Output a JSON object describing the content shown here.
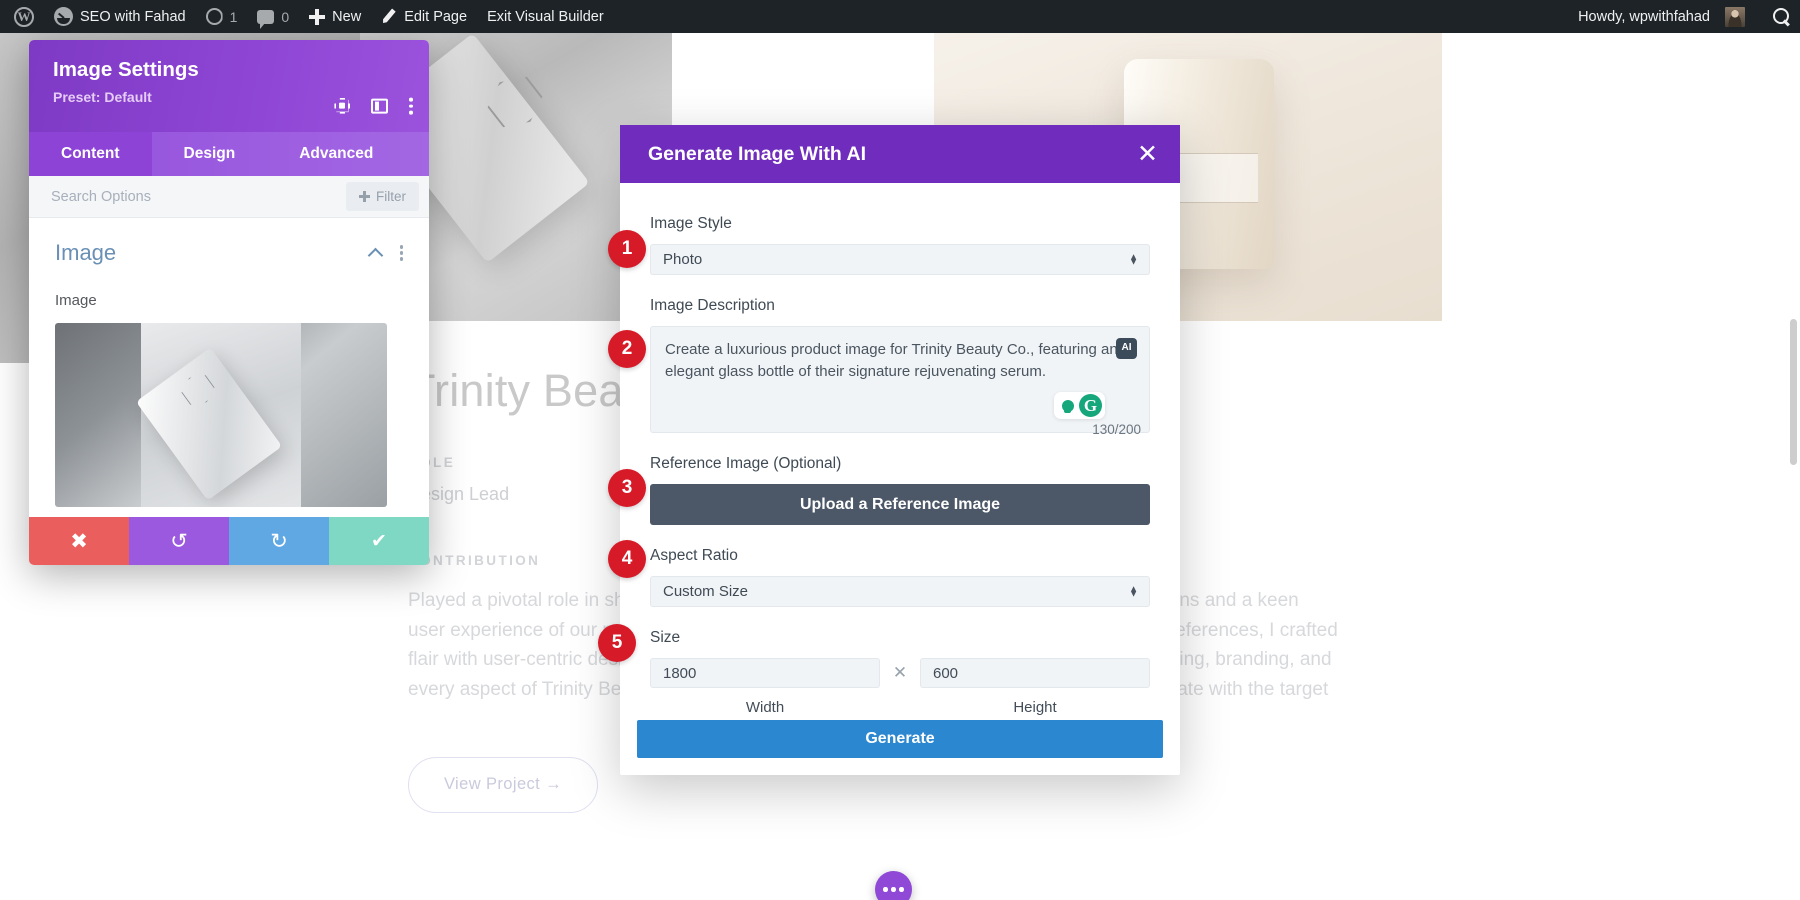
{
  "adminbar": {
    "logo_icon": "wordpress-logo-icon",
    "site_name": "SEO with Fahad",
    "updates_count": "1",
    "comments_count": "0",
    "new_label": "New",
    "edit_page_label": "Edit Page",
    "exit_builder_label": "Exit Visual Builder",
    "howdy": "Howdy, wpwithfahad",
    "search_icon": "search-icon"
  },
  "divi_panel": {
    "title": "Image Settings",
    "preset": "Preset: Default",
    "tabs": [
      {
        "label": "Content",
        "active": true
      },
      {
        "label": "Design",
        "active": false
      },
      {
        "label": "Advanced",
        "active": false
      }
    ],
    "search_placeholder": "Search Options",
    "filter_label": "Filter",
    "section_title": "Image",
    "field_label": "Image",
    "footer": {
      "cancel_icon": "✖",
      "undo_icon": "↺",
      "redo_icon": "↻",
      "save_icon": "✔"
    }
  },
  "ai_modal": {
    "title": "Generate Image With AI",
    "close_icon": "✕",
    "image_style": {
      "label": "Image Style",
      "value": "Photo"
    },
    "image_description": {
      "label": "Image Description",
      "value": "Create a luxurious product image for Trinity Beauty Co., featuring an elegant glass bottle of their signature rejuvenating serum.",
      "ai_badge": "AI",
      "char_count": "130/200"
    },
    "reference_image": {
      "label": "Reference Image (Optional)",
      "button": "Upload a Reference Image"
    },
    "aspect_ratio": {
      "label": "Aspect Ratio",
      "value": "Custom Size"
    },
    "size": {
      "label": "Size",
      "width_value": "1800",
      "height_value": "600",
      "separator": "✕",
      "width_caption": "Width",
      "height_caption": "Height"
    },
    "generate_button": "Generate"
  },
  "badges": [
    {
      "n": "1"
    },
    {
      "n": "2"
    },
    {
      "n": "3"
    },
    {
      "n": "4"
    },
    {
      "n": "5"
    }
  ],
  "page": {
    "heading": "Trinity Beauty — Trinity Belle Co.",
    "role_label": "ROLE",
    "role_value": "Design Lead",
    "contribution_label": "CONTRIBUTION",
    "contribution_text": "Played a pivotal role in shaping the visual identity and user experience of our product line. Blending creative flair with user-centric design principles, I influenced every aspect of Trinity Beauty's presentation.",
    "approach_text": "Guided by data-driven decisions and a keen understanding of customer preferences, I crafted experiences spanning packaging, branding, and product storytelling that resonate with the target audience.",
    "cta_label": "View Project →",
    "fab_icon": "more-options-icon"
  },
  "colors": {
    "admin_bar": "#1d2327",
    "divi_purple": "#8e45d4",
    "modal_purple": "#6f2cbd",
    "generate_blue": "#2a87d0",
    "badge_red": "#d71a28",
    "upload_dark": "#4c5867"
  }
}
